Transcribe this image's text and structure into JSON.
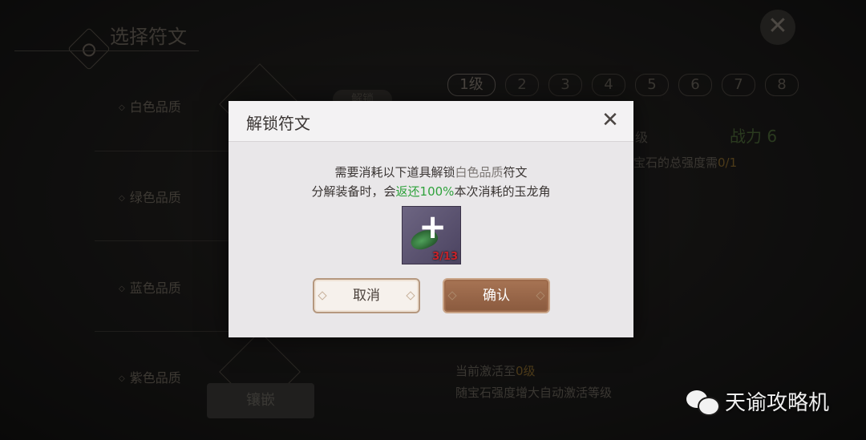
{
  "background": {
    "title": "选择符文",
    "close_label": "✕",
    "qualities": [
      "白色品质",
      "绿色品质",
      "蓝色品质",
      "紫色品质"
    ],
    "unlock_pill": "解锁",
    "levels": [
      "1级",
      "2",
      "3",
      "4",
      "5",
      "6",
      "7",
      "8"
    ],
    "level_label": "级",
    "power": "战力 6",
    "gem_text_prefix": "宝石的总强度需",
    "gem_text_value": "0/1",
    "activate_prefix": "当前激活至",
    "activate_value": "0级",
    "auto_activate": "随宝石强度增大自动激活等级",
    "inlay_button": "镶嵌"
  },
  "dialog": {
    "title": "解锁符文",
    "close_label": "✕",
    "message_line1_a": "需要消耗以下道具解锁",
    "message_line1_highlight": "白色品质",
    "message_line1_b": "符文",
    "message_line2_a": "分解装备时，会",
    "message_line2_highlight": "返还100%",
    "message_line2_b": "本次消耗的玉龙角",
    "item": {
      "icon": "jade-dragon-horn-icon",
      "count": "3/13"
    },
    "cancel_label": "取消",
    "confirm_label": "确认",
    "colors": {
      "highlight_green": "#2fa23c",
      "highlight_gray": "#7b7673",
      "count_red": "#c8232a",
      "confirm_brown": "#8a5a3e"
    }
  },
  "watermark": {
    "text": "天谕攻略机",
    "icon": "wechat-icon"
  }
}
